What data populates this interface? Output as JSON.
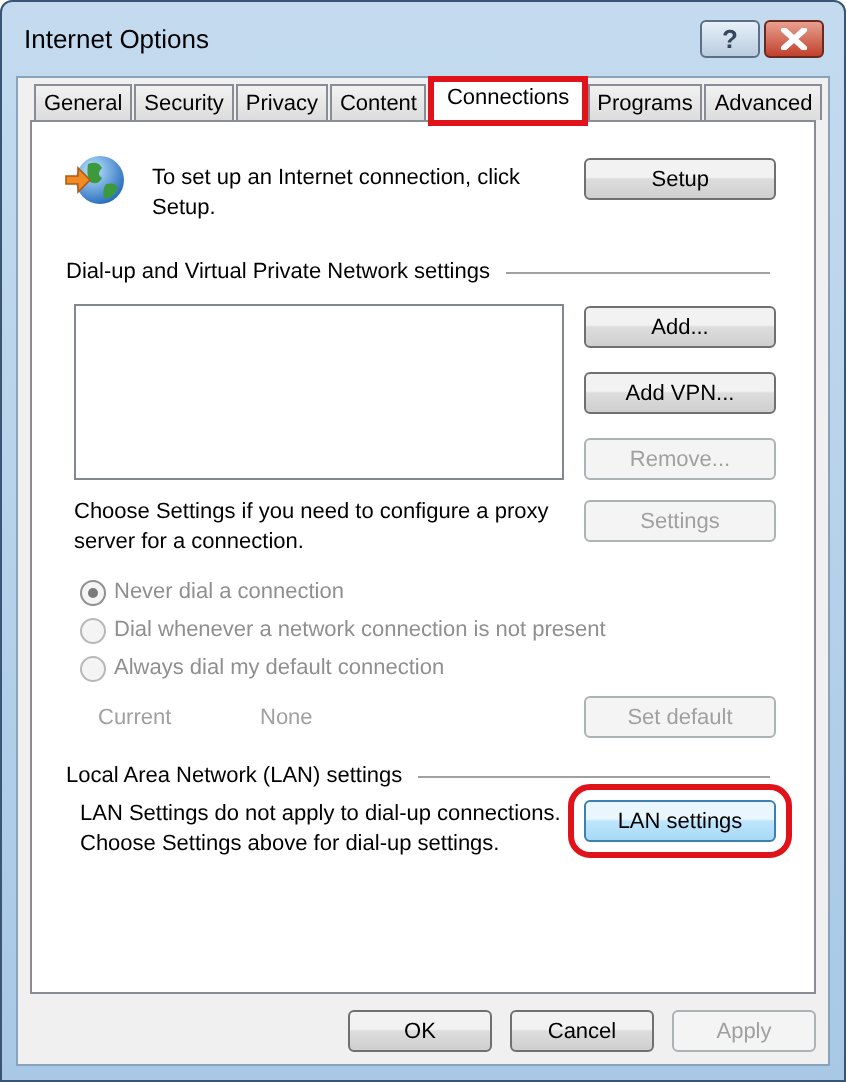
{
  "window": {
    "title": "Internet Options",
    "help_button": "?"
  },
  "tabs": [
    {
      "label": "General",
      "selected": false,
      "highlighted": false
    },
    {
      "label": "Security",
      "selected": false,
      "highlighted": false
    },
    {
      "label": "Privacy",
      "selected": false,
      "highlighted": false
    },
    {
      "label": "Content",
      "selected": false,
      "highlighted": false
    },
    {
      "label": "Connections",
      "selected": true,
      "highlighted": true
    },
    {
      "label": "Programs",
      "selected": false,
      "highlighted": false
    },
    {
      "label": "Advanced",
      "selected": false,
      "highlighted": false
    }
  ],
  "setup": {
    "text": "To set up an Internet connection, click\nSetup.",
    "button": {
      "label": "Setup",
      "disabled": false
    }
  },
  "dialup": {
    "heading": "Dial-up and Virtual Private Network settings",
    "buttons": [
      {
        "label": "Add...",
        "disabled": false
      },
      {
        "label": "Add VPN...",
        "disabled": false
      },
      {
        "label": "Remove...",
        "disabled": true
      }
    ],
    "proxy_note": "Choose Settings if you need to configure a proxy\nserver for a connection.",
    "settings_button": {
      "label": "Settings",
      "disabled": true
    },
    "options_disabled": true,
    "options": [
      {
        "label": "Never dial a connection",
        "selected": true
      },
      {
        "label": "Dial whenever a network connection is not present",
        "selected": false
      },
      {
        "label": "Always dial my default connection",
        "selected": false
      }
    ],
    "current": {
      "label": "Current",
      "value": "None"
    },
    "set_default_button": {
      "label": "Set default",
      "disabled": true
    }
  },
  "lan": {
    "heading": "Local Area Network (LAN) settings",
    "note": "LAN Settings do not apply to dial-up connections.\nChoose Settings above for dial-up settings.",
    "button": {
      "label": "LAN settings",
      "disabled": false,
      "highlighted": true
    }
  },
  "footer_buttons": [
    {
      "label": "OK",
      "disabled": false
    },
    {
      "label": "Cancel",
      "disabled": false
    },
    {
      "label": "Apply",
      "disabled": true
    }
  ]
}
